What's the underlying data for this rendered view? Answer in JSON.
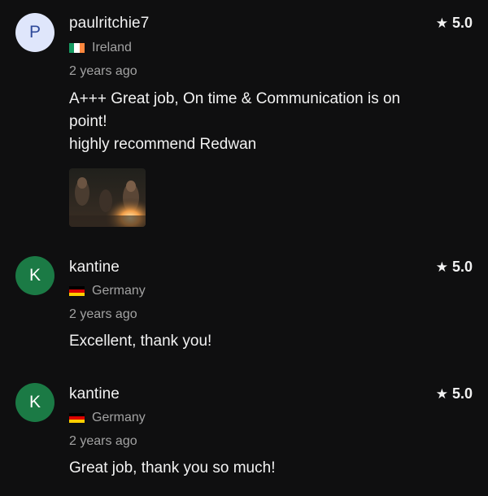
{
  "reviews": [
    {
      "avatar_letter": "P",
      "username": "paulritchie7",
      "country": "Ireland",
      "flag": "ireland-flag-icon",
      "time": "2 years ago",
      "rating": "5.0",
      "text_lines": [
        "A+++ Great job, On time & Communication is on",
        "point!",
        "highly recommend Redwan"
      ],
      "has_image": true
    },
    {
      "avatar_letter": "K",
      "username": "kantine",
      "country": "Germany",
      "flag": "germany-flag-icon",
      "time": "2 years ago",
      "rating": "5.0",
      "text_lines": [
        "Excellent, thank you!"
      ]
    },
    {
      "avatar_letter": "K",
      "username": "kantine",
      "country": "Germany",
      "flag": "germany-flag-icon",
      "time": "2 years ago",
      "rating": "5.0",
      "text_lines": [
        "Great job, thank you so much!"
      ]
    }
  ],
  "icons": {
    "star": "star-icon"
  },
  "colors": {
    "background": "#0f0f10",
    "avatar_p_bg": "#dfe6fb",
    "avatar_p_fg": "#2f4a9a",
    "avatar_k_bg": "#1b7a45",
    "muted_text": "#a2a2a2"
  }
}
